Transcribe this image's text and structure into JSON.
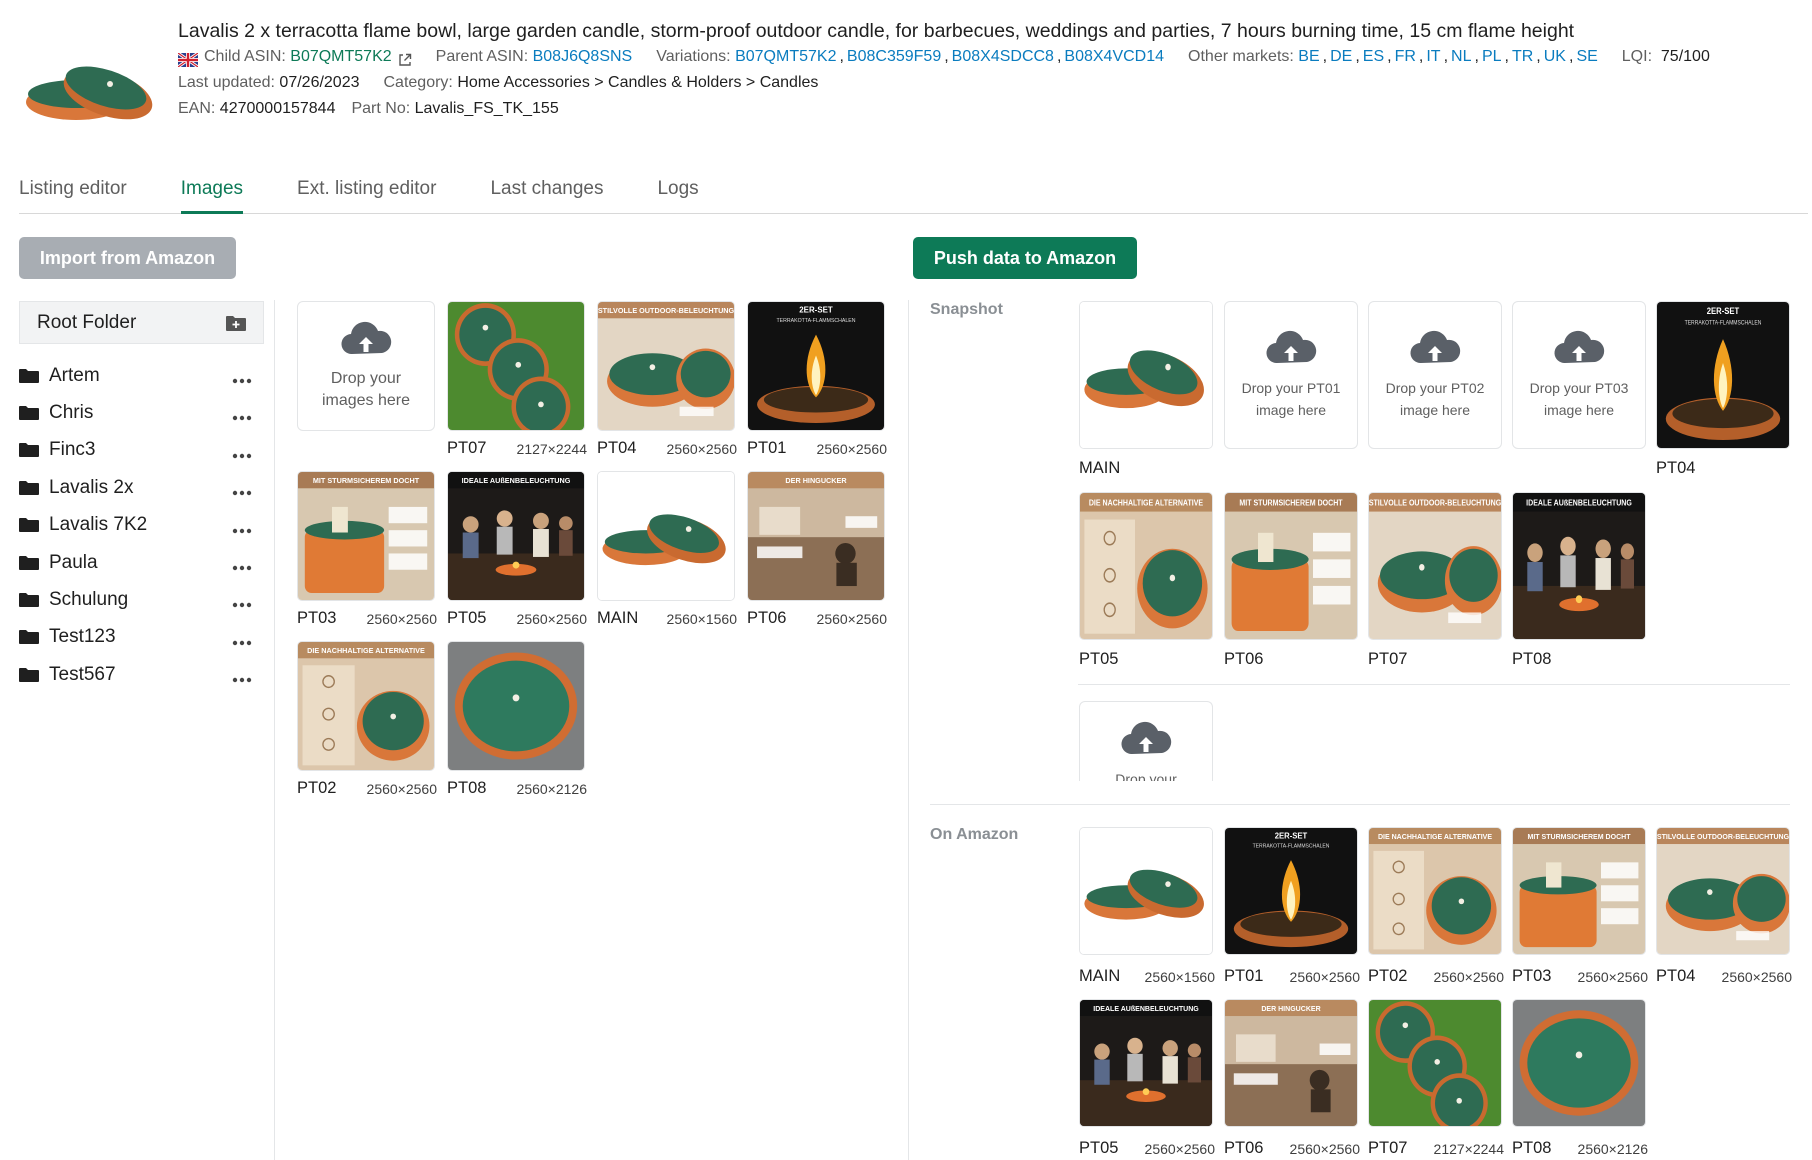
{
  "product": {
    "title": "Lavalis 2 x terracotta flame bowl, large garden candle, storm-proof outdoor candle, for barbecues, weddings and parties, 7 hours burning time, 15 cm flame height",
    "child_asin_label": "Child ASIN:",
    "child_asin": "B07QMT57K2",
    "parent_asin_label": "Parent ASIN:",
    "parent_asin": "B08J6Q8SNS",
    "variations_label": "Variations:",
    "variations": [
      "B07QMT57K2",
      "B08C359F59",
      "B08X4SDCC8",
      "B08X4VCD14"
    ],
    "other_markets_label": "Other markets:",
    "other_markets": [
      "BE",
      "DE",
      "ES",
      "FR",
      "IT",
      "NL",
      "PL",
      "TR",
      "UK",
      "SE"
    ],
    "lqi_label": "LQI:",
    "lqi": "75/100",
    "last_updated_label": "Last updated:",
    "last_updated": "07/26/2023",
    "category_label": "Category:",
    "category": "Home Accessories > Candles & Holders > Candles",
    "ean_label": "EAN:",
    "ean": "4270000157844",
    "part_no_label": "Part No:",
    "part_no": "Lavalis_FS_TK_155"
  },
  "tabs": [
    "Listing editor",
    "Images",
    "Ext. listing editor",
    "Last changes",
    "Logs"
  ],
  "active_tab": "Images",
  "buttons": {
    "import": "Import from Amazon",
    "push": "Push data to Amazon"
  },
  "folders": {
    "root": "Root Folder",
    "items": [
      "Artem",
      "Chris",
      "Finc3",
      "Lavalis 2x",
      "Lavalis 7K2",
      "Paula",
      "Schulung",
      "Test123",
      "Test567"
    ]
  },
  "library": {
    "drop_text": "Drop your images here",
    "images": [
      {
        "name": "PT07",
        "dims": "2127×2244",
        "kind": "grass"
      },
      {
        "name": "PT04",
        "dims": "2560×2560",
        "kind": "outdoor"
      },
      {
        "name": "PT01",
        "dims": "2560×2560",
        "kind": "flame"
      },
      {
        "name": "PT03",
        "dims": "2560×2560",
        "kind": "wick"
      },
      {
        "name": "PT05",
        "dims": "2560×2560",
        "kind": "party"
      },
      {
        "name": "MAIN",
        "dims": "2560×1560",
        "kind": "bowls"
      },
      {
        "name": "PT06",
        "dims": "2560×2560",
        "kind": "hingucker"
      },
      {
        "name": "PT02",
        "dims": "2560×2560",
        "kind": "alternative"
      },
      {
        "name": "PT08",
        "dims": "2560×2126",
        "kind": "topview"
      }
    ]
  },
  "snapshot": {
    "label": "Snapshot",
    "slots": [
      {
        "name": "MAIN",
        "kind": "bowls"
      },
      {
        "name": "",
        "drop_text": "Drop your PT01 image here"
      },
      {
        "name": "",
        "drop_text": "Drop your PT02 image here"
      },
      {
        "name": "",
        "drop_text": "Drop your PT03 image here"
      },
      {
        "name": "PT04",
        "kind": "flame"
      },
      {
        "name": "PT05",
        "kind": "alternative"
      },
      {
        "name": "PT06",
        "kind": "wick"
      },
      {
        "name": "PT07",
        "kind": "outdoor"
      },
      {
        "name": "PT08",
        "kind": "party"
      }
    ],
    "extra_drop_text": "Drop your"
  },
  "on_amazon": {
    "label": "On Amazon",
    "images": [
      {
        "name": "MAIN",
        "dims": "2560×1560",
        "kind": "bowls"
      },
      {
        "name": "PT01",
        "dims": "2560×2560",
        "kind": "flame"
      },
      {
        "name": "PT02",
        "dims": "2560×2560",
        "kind": "alternative"
      },
      {
        "name": "PT03",
        "dims": "2560×2560",
        "kind": "wick"
      },
      {
        "name": "PT04",
        "dims": "2560×2560",
        "kind": "outdoor"
      },
      {
        "name": "PT05",
        "dims": "2560×2560",
        "kind": "party"
      },
      {
        "name": "PT06",
        "dims": "2560×2560",
        "kind": "hingucker"
      },
      {
        "name": "PT07",
        "dims": "2127×2244",
        "kind": "grass"
      },
      {
        "name": "PT08",
        "dims": "2560×2126",
        "kind": "topview"
      }
    ]
  },
  "thumb_text": {
    "outdoor": "STILVOLLE OUTDOOR-BELEUCHTUNG",
    "flame": "2ER-SET",
    "flame_sub": "TERRAKOTTA-FLAMMSCHALEN",
    "wick": "MIT STURMSICHEREM DOCHT",
    "party": "IDEALE AUßENBELEUCHTUNG",
    "hingucker": "DER HINGUCKER",
    "alternative": "DIE NACHHALTIGE ALTERNATIVE"
  },
  "colors": {
    "accent": "#0d7a57",
    "link": "#0a7cbf",
    "terracotta": "#d9773a",
    "candle_green": "#2e6b52",
    "import_button": "#a8adb3"
  }
}
